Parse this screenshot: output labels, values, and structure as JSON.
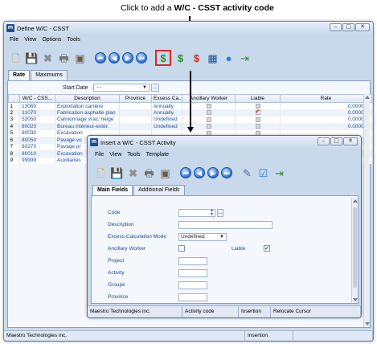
{
  "caption": {
    "prefix": "Click to add a ",
    "bold": "W/C - CSST activity code"
  },
  "main_window": {
    "title": "Define W/C - CSST",
    "app_icon": "m",
    "menu": [
      "File",
      "View",
      "Options",
      "Tools"
    ],
    "tabs": [
      "Rate",
      "Maximums"
    ],
    "start_date_label": "Start Date",
    "start_date_value": "- -",
    "columns": [
      "W/C - CSS...",
      "Description",
      "Province",
      "Excess Ca...",
      "Ancillary Worker",
      "Liable",
      "Rate"
    ],
    "rows": [
      {
        "num": "1",
        "code": "13060",
        "desc": "Exploitation carrière",
        "province": "",
        "excess": "Annually",
        "ancillary": false,
        "liable": false,
        "rate": "0.000000"
      },
      {
        "num": "2",
        "code": "31070",
        "desc": "Fabrication asphalte plan",
        "province": "",
        "excess": "Annually",
        "ancillary": false,
        "liable": true,
        "rate": "0.000000"
      },
      {
        "num": "3",
        "code": "52050",
        "desc": "Camionnage vrac, neige",
        "province": "",
        "excess": "Undefined",
        "ancillary": false,
        "liable": false,
        "rate": "0.000000"
      },
      {
        "num": "4",
        "code": "80020",
        "desc": "Bureau intérieur-extér.",
        "province": "",
        "excess": "Undefined",
        "ancillary": false,
        "liable": false,
        "rate": "0.000000"
      },
      {
        "num": "5",
        "code": "80030",
        "desc": "Excavation",
        "province": "",
        "excess": "",
        "ancillary": false,
        "liable": false,
        "rate": ""
      },
      {
        "num": "6",
        "code": "80050",
        "desc": "Pavage vo",
        "province": "",
        "excess": "",
        "ancillary": false,
        "liable": false,
        "rate": ""
      },
      {
        "num": "7",
        "code": "80270",
        "desc": "Pavage pr",
        "province": "",
        "excess": "",
        "ancillary": false,
        "liable": false,
        "rate": ""
      },
      {
        "num": "8",
        "code": "80010",
        "desc": "Excavation",
        "province": "",
        "excess": "",
        "ancillary": false,
        "liable": false,
        "rate": ""
      },
      {
        "num": "9",
        "code": "99999",
        "desc": "Auxiliaires",
        "province": "",
        "excess": "",
        "ancillary": false,
        "liable": false,
        "rate": ""
      }
    ],
    "status": [
      "Maestro Technologies inc.",
      "Insertion"
    ]
  },
  "dialog": {
    "title": "Insert a W/C - CSST Activity",
    "app_icon": "m",
    "menu": [
      "File",
      "View",
      "Tools",
      "Template"
    ],
    "tabs": [
      "Main Fields",
      "Additional Fields"
    ],
    "fields": {
      "code_label": "Code",
      "description_label": "Description",
      "excess_mode_label": "Excess Calculation Mode",
      "excess_mode_value": "Undefined",
      "ancillary_label": "Ancillary Worker",
      "liable_label": "Liable",
      "project_label": "Project",
      "activity_label": "Activity",
      "groupe_label": "Groupe",
      "province_label": "Province"
    },
    "status": [
      "Maestro Technologies inc.",
      "Activity code",
      "Insertion",
      "Relocate Cursor"
    ]
  },
  "colors": {
    "highlight_box": "#d9262c",
    "window_bg": "#c9d9ec",
    "link_blue": "#1a4ea0"
  }
}
